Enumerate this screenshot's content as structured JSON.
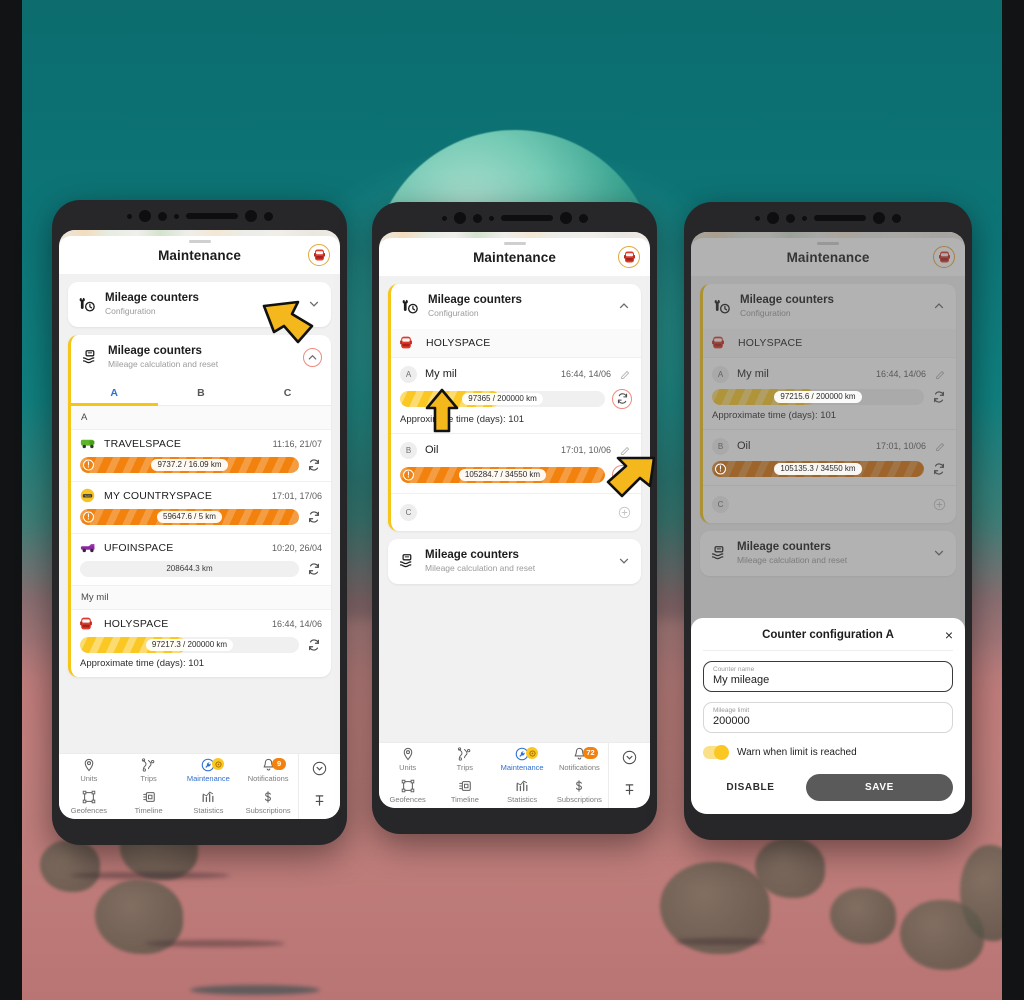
{
  "app": {
    "title": "Maintenance",
    "vehicle_icon": "car-icon"
  },
  "cards": {
    "config": {
      "title": "Mileage counters",
      "subtitle": "Configuration"
    },
    "calc": {
      "title": "Mileage counters",
      "subtitle": "Mileage calculation and reset"
    }
  },
  "tabs": [
    {
      "label": "A",
      "selected": true
    },
    {
      "label": "B",
      "selected": false
    },
    {
      "label": "C",
      "selected": false
    }
  ],
  "phone1": {
    "group_label": "A",
    "units": [
      {
        "name": "TRAVELSPACE",
        "icon": "green-van-icon",
        "time": "11:16, 21/07",
        "bar": {
          "label": "9737.2 / 16.09 km",
          "fill_pct": 100,
          "style": "orange",
          "warning": true
        }
      },
      {
        "name": "MY COUNTRYSPACE",
        "icon": "yellow-taxi-icon",
        "time": "17:01, 17/06",
        "bar": {
          "label": "59647.6 / 5 km",
          "fill_pct": 100,
          "style": "orange",
          "warning": true
        }
      },
      {
        "name": "UFOINSPACE",
        "icon": "purple-truck-icon",
        "time": "10:20, 26/04",
        "bar": {
          "label": "208644.3 km",
          "fill_pct": 0,
          "style": "none",
          "warning": false
        }
      }
    ],
    "group2_label": "My mil",
    "units2": [
      {
        "name": "HOLYSPACE",
        "icon": "red-car-icon",
        "time": "16:44, 14/06",
        "bar": {
          "label": "97217.3 / 200000 km",
          "fill_pct": 48.6,
          "style": "yellow",
          "warning": false
        },
        "approx": "Approximate time (days): 101"
      }
    ]
  },
  "phone2": {
    "unit_header": {
      "name": "HOLYSPACE",
      "icon": "red-car-icon"
    },
    "counters": [
      {
        "badge": "A",
        "name": "My mil",
        "time": "16:44, 14/06",
        "bar": {
          "label": "97365 / 200000 km",
          "fill_pct": 48.7,
          "style": "yellow",
          "warning": false
        },
        "approx": "Approximate time (days): 101"
      },
      {
        "badge": "B",
        "name": "Oil",
        "time": "17:01, 10/06",
        "bar": {
          "label": "105284.7 / 34550 km",
          "fill_pct": 100,
          "style": "orange",
          "warning": true
        },
        "approx": ""
      },
      {
        "badge": "C",
        "name": "",
        "time": "",
        "bar": null,
        "approx": ""
      }
    ]
  },
  "phone3": {
    "unit_header": {
      "name": "HOLYSPACE",
      "icon": "red-car-icon"
    },
    "counters": [
      {
        "badge": "A",
        "name": "My mil",
        "time": "16:44, 14/06",
        "bar": {
          "label": "97215.6 / 200000 km",
          "fill_pct": 48.6,
          "style": "yellow",
          "warning": false
        },
        "approx": "Approximate time (days): 101"
      },
      {
        "badge": "B",
        "name": "Oil",
        "time": "17:01, 10/06",
        "bar": {
          "label": "105135.3 / 34550 km",
          "fill_pct": 100,
          "style": "orange-dark",
          "warning": true
        },
        "approx": ""
      },
      {
        "badge": "C",
        "name": "",
        "time": "",
        "bar": null,
        "approx": ""
      }
    ],
    "dialog": {
      "title": "Counter configuration A",
      "close_label": "×",
      "counter_name": {
        "label": "Counter name",
        "value": "My mileage"
      },
      "mileage_limit": {
        "label": "Mileage limit",
        "value": "200000"
      },
      "warn_toggle": {
        "label": "Warn when limit is reached",
        "on": true
      },
      "disable_label": "DISABLE",
      "save_label": "SAVE"
    }
  },
  "bottom_nav": {
    "row1": [
      {
        "label": "Units",
        "icon": "pin-icon",
        "selected": false,
        "badge": null
      },
      {
        "label": "Trips",
        "icon": "route-icon",
        "selected": false,
        "badge": null
      },
      {
        "label": "Maintenance",
        "icon": "wrench-icon",
        "selected": true,
        "badge": "dot"
      },
      {
        "label": "Notifications",
        "icon": "bell-icon",
        "selected": false,
        "badge": "9"
      }
    ],
    "row2": [
      {
        "label": "Geofences",
        "icon": "polygon-icon",
        "selected": false
      },
      {
        "label": "Timeline",
        "icon": "timeline-icon",
        "selected": false
      },
      {
        "label": "Statistics",
        "icon": "chart-icon",
        "selected": false
      },
      {
        "label": "Subscriptions",
        "icon": "dollar-icon",
        "selected": false
      }
    ],
    "side": [
      {
        "icon": "collapse-chevron-icon"
      },
      {
        "icon": "pin-tack-icon"
      }
    ],
    "phone2_notifications_badge": "72"
  },
  "colors": {
    "accent_yellow": "#f5c518",
    "orange": "#f2810d",
    "orange_dark": "#d9730a",
    "blue": "#2f6fd0",
    "arrow": "#f5b81c",
    "background_teal": "#0d7577",
    "background_rose": "#c07f7c"
  }
}
